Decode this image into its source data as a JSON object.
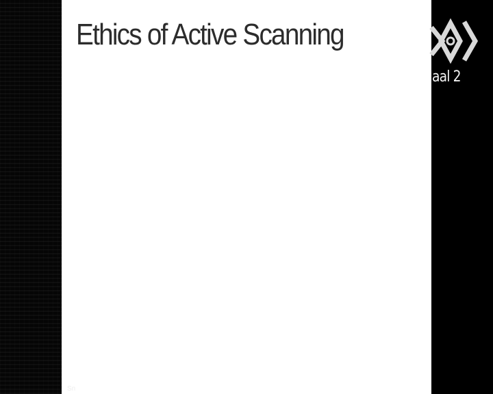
{
  "slide": {
    "title": "Ethics of Active Scanning",
    "footer": "Sn"
  },
  "broadcast": {
    "channel_name": "aal 2",
    "logo_icon": "channel-logo-icon"
  },
  "colors": {
    "background": "#000000",
    "slide": "#ffffff",
    "title": "#2c2c2c",
    "logo": "#d9d9d9"
  }
}
